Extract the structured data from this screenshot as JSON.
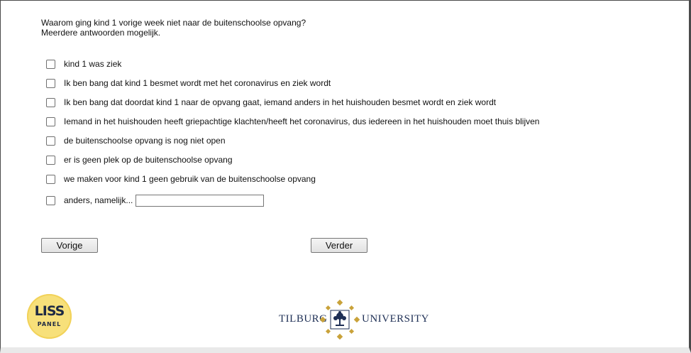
{
  "question": {
    "line1": "Waarom ging kind 1 vorige week niet naar de buitenschoolse opvang?",
    "line2": "Meerdere antwoorden mogelijk."
  },
  "options": [
    {
      "label": "kind 1 was ziek",
      "checked": false
    },
    {
      "label": "Ik ben bang dat kind 1 besmet wordt met het coronavirus en ziek wordt",
      "checked": false
    },
    {
      "label": "Ik ben bang dat doordat kind 1 naar de opvang gaat, iemand anders in het huishouden besmet wordt en ziek wordt",
      "checked": false
    },
    {
      "label": "Iemand in het huishouden heeft griepachtige klachten/heeft het coronavirus, dus iedereen in het huishouden moet thuis blijven",
      "checked": false
    },
    {
      "label": "de buitenschoolse opvang is nog niet open",
      "checked": false
    },
    {
      "label": "er is geen plek op de buitenschoolse opvang",
      "checked": false
    },
    {
      "label": "we maken voor kind 1 geen gebruik van de buitenschoolse opvang",
      "checked": false
    },
    {
      "label": "anders, namelijk...",
      "checked": false,
      "text_value": ""
    }
  ],
  "buttons": {
    "prev": "Vorige",
    "next": "Verder"
  },
  "logos": {
    "liss_word": "LISS",
    "liss_sub": "PANEL",
    "tilburg_left": "TILBURG",
    "tilburg_right": "UNIVERSITY"
  },
  "colors": {
    "liss_yellow": "#f7e07a",
    "tilburg_navy": "#1e2f55",
    "tilburg_gold": "#c9a23a"
  }
}
